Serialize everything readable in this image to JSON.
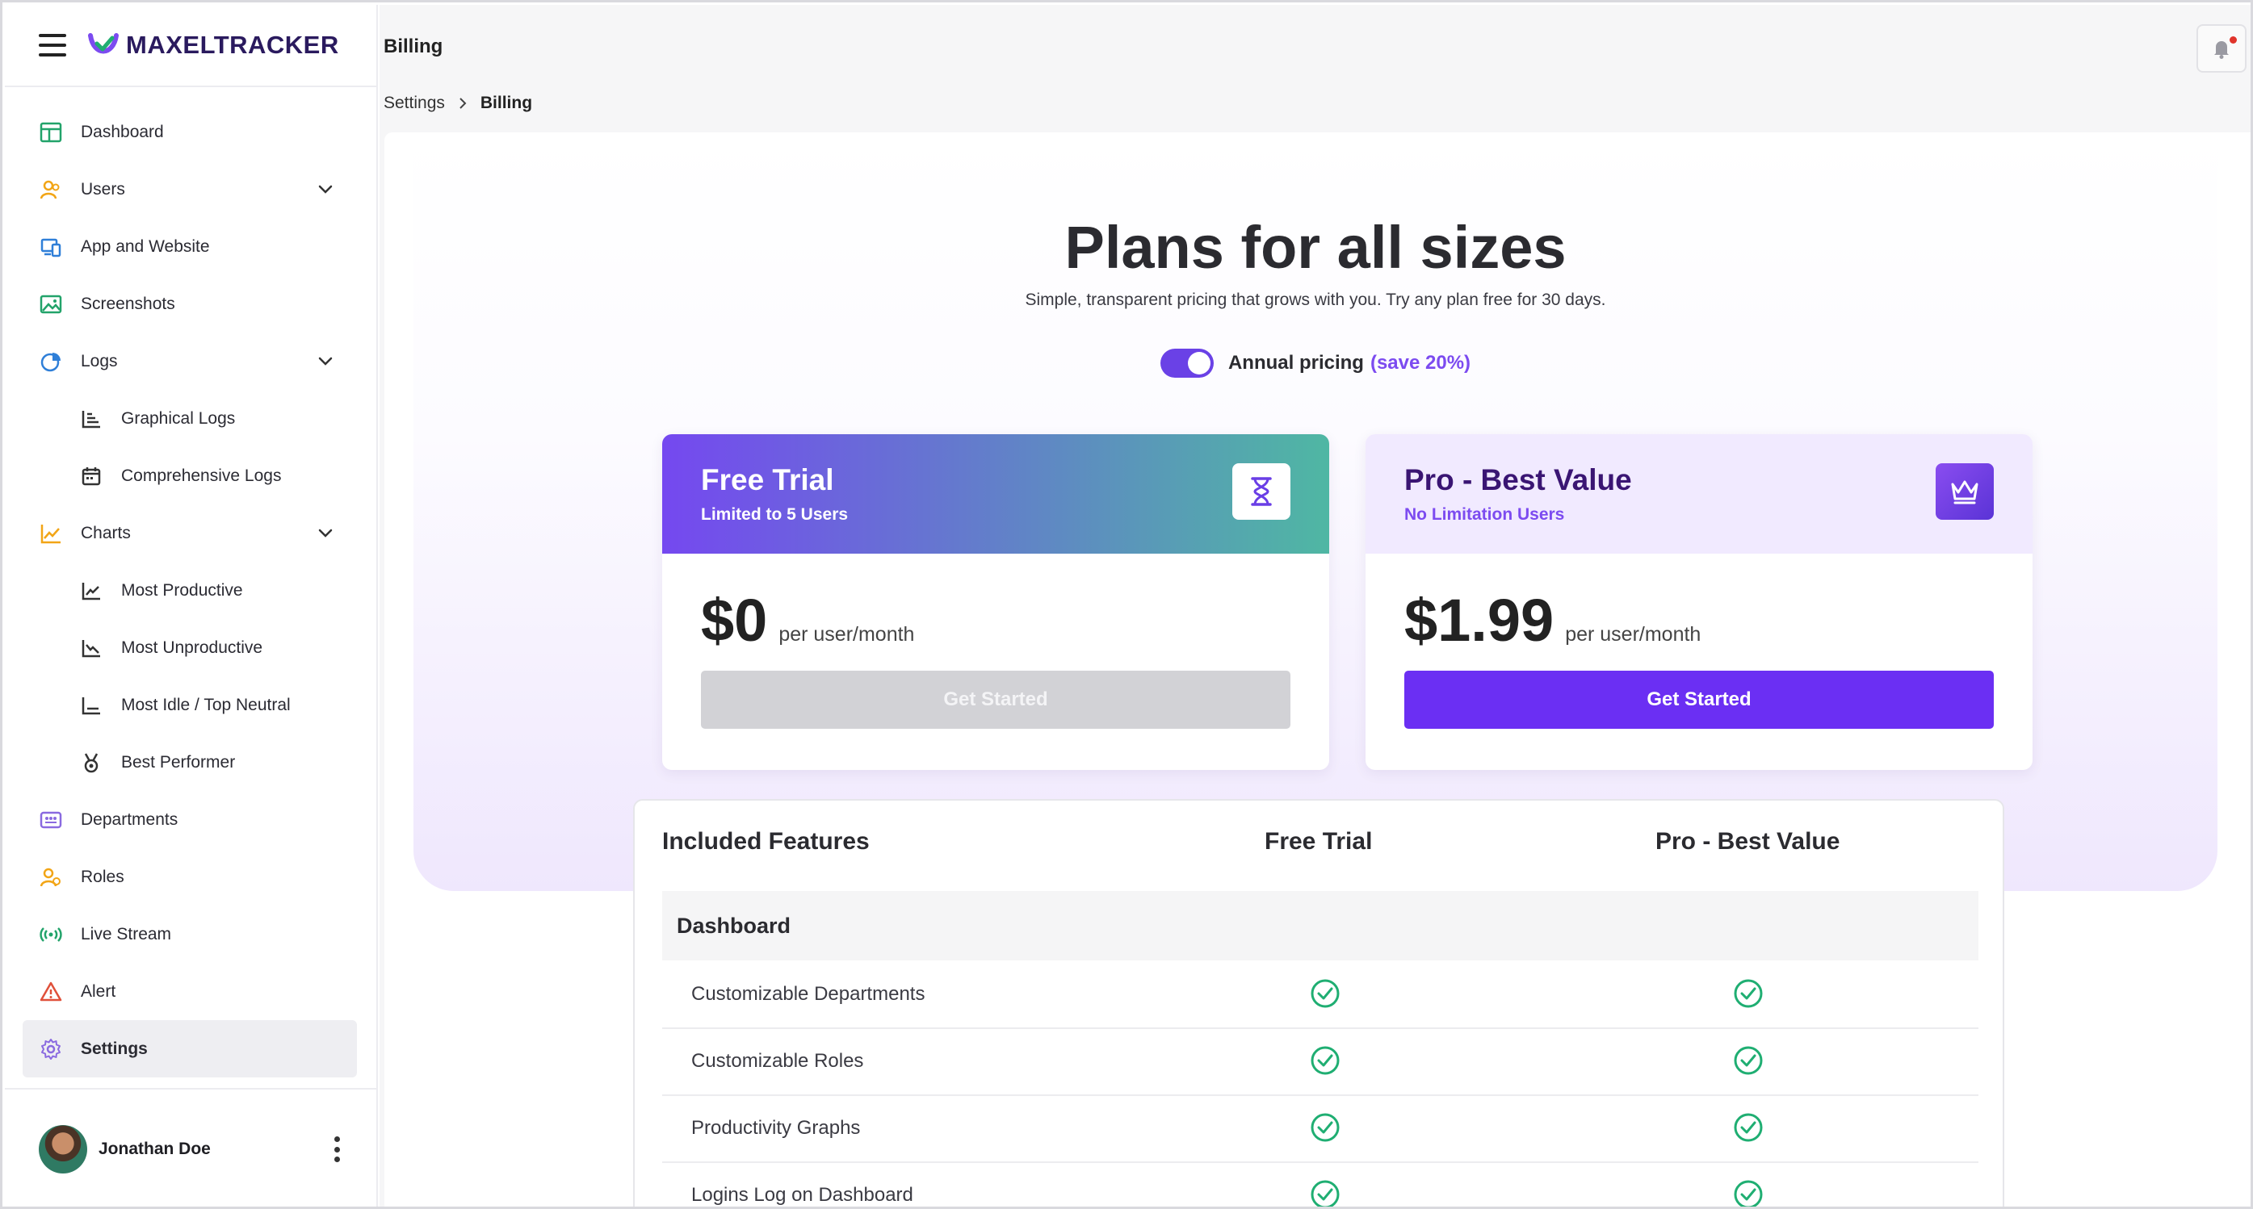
{
  "app": {
    "logo_text": "MAXELTRACKER",
    "brand_color": "#6b2ff3"
  },
  "sidebar": {
    "items": [
      {
        "label": "Dashboard",
        "icon": "dashboard-icon"
      },
      {
        "label": "Users",
        "icon": "users-icon"
      },
      {
        "label": "App and Website",
        "icon": "devices-icon"
      },
      {
        "label": "Screenshots",
        "icon": "image-icon"
      },
      {
        "label": "Logs",
        "icon": "pie-chart-icon"
      },
      {
        "label": "Graphical Logs",
        "icon": "bar-chart-icon"
      },
      {
        "label": "Comprehensive Logs",
        "icon": "calendar-icon"
      },
      {
        "label": "Charts",
        "icon": "line-chart-icon"
      },
      {
        "label": "Most Productive",
        "icon": "trend-up-icon"
      },
      {
        "label": "Most Unproductive",
        "icon": "trend-down-icon"
      },
      {
        "label": "Most Idle / Top Neutral",
        "icon": "axis-icon"
      },
      {
        "label": "Best Performer",
        "icon": "medal-icon"
      },
      {
        "label": "Departments",
        "icon": "department-icon"
      },
      {
        "label": "Roles",
        "icon": "roles-icon"
      },
      {
        "label": "Live Stream",
        "icon": "broadcast-icon"
      },
      {
        "label": "Alert",
        "icon": "alert-icon"
      },
      {
        "label": "Settings",
        "icon": "gear-icon"
      }
    ],
    "user": {
      "name": "Jonathan Doe"
    }
  },
  "header": {
    "title": "Billing"
  },
  "breadcrumb": {
    "parent": "Settings",
    "current": "Billing"
  },
  "hero": {
    "title": "Plans for all sizes",
    "subtitle": "Simple, transparent pricing that grows with you. Try any plan free for 30 days.",
    "toggle_label": "Annual pricing",
    "toggle_save": "(save 20%)",
    "toggle_on": true
  },
  "plans": [
    {
      "name": "Free Trial",
      "limit": "Limited to 5 Users",
      "price": "$0",
      "per": "per user/month",
      "cta": "Get Started",
      "icon": "hourglass-icon"
    },
    {
      "name": "Pro - Best Value",
      "limit": "No Limitation Users",
      "price": "$1.99",
      "per": "per user/month",
      "cta": "Get Started",
      "icon": "crown-icon"
    }
  ],
  "features": {
    "headers": [
      "Included Features",
      "Free Trial",
      "Pro - Best Value"
    ],
    "section": "Dashboard",
    "rows": [
      {
        "name": "Customizable Departments"
      },
      {
        "name": "Customizable Roles"
      },
      {
        "name": "Productivity Graphs"
      },
      {
        "name": "Logins Log on Dashboard"
      }
    ]
  },
  "colors": {
    "check": "#1fae72",
    "accent": "#7c4bf0"
  }
}
